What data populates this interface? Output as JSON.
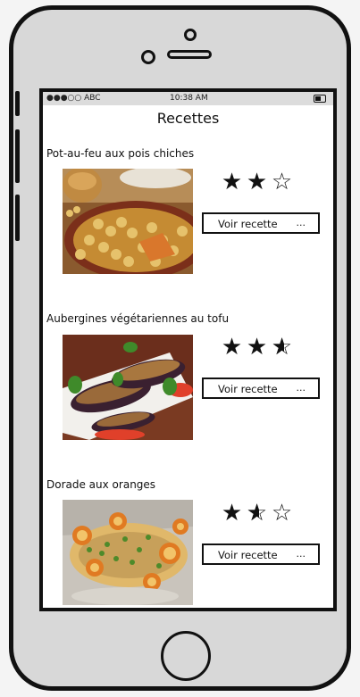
{
  "status_bar": {
    "carrier": "●●●○○ ABC",
    "time": "10:38 AM"
  },
  "page_title": "Recettes",
  "recipes": [
    {
      "name": "Pot-au-feu aux pois chiches",
      "rating": 2,
      "button": "Voir recette",
      "button_more": "..."
    },
    {
      "name": "Aubergines végétariennes au tofu",
      "rating": 2.5,
      "button": "Voir recette",
      "button_more": "..."
    },
    {
      "name": "Dorade aux oranges",
      "rating": 1.5,
      "button": "Voir recette",
      "button_more": "..."
    }
  ]
}
